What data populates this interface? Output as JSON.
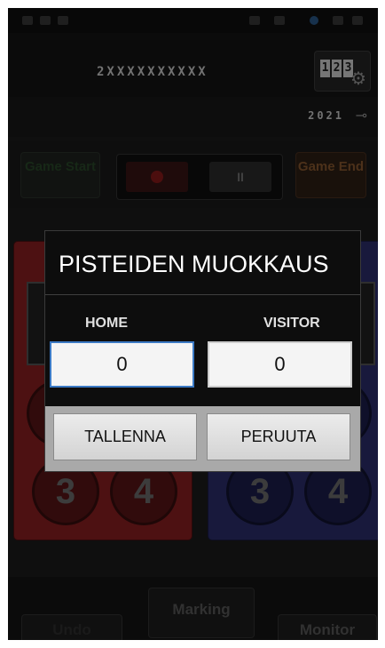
{
  "device": {
    "serial": "2XXXXXXXXXX",
    "settings_digits": [
      "1",
      "2",
      "3"
    ],
    "battery_text": "2021"
  },
  "controls": {
    "game_start_label": "Game Start",
    "pause_label": "II",
    "game_end_label": "Game End"
  },
  "scoreboard": {
    "home_circles": [
      "3",
      "4"
    ],
    "visitor_circles": [
      "3",
      "4"
    ]
  },
  "bottom_bar": {
    "undo_label": "Undo",
    "marking_label": "Marking",
    "monitor_label": "Monitor"
  },
  "dialog": {
    "title": "PISTEIDEN MUOKKAUS",
    "home_label": "HOME",
    "visitor_label": "VISITOR",
    "home_value": "0",
    "visitor_value": "0",
    "save_label": "TALLENNA",
    "cancel_label": "PERUUTA"
  },
  "colors": {
    "home_panel": "#8c1f22",
    "visitor_panel": "#2c2f6e",
    "input_focus_border": "#3b79c4"
  }
}
